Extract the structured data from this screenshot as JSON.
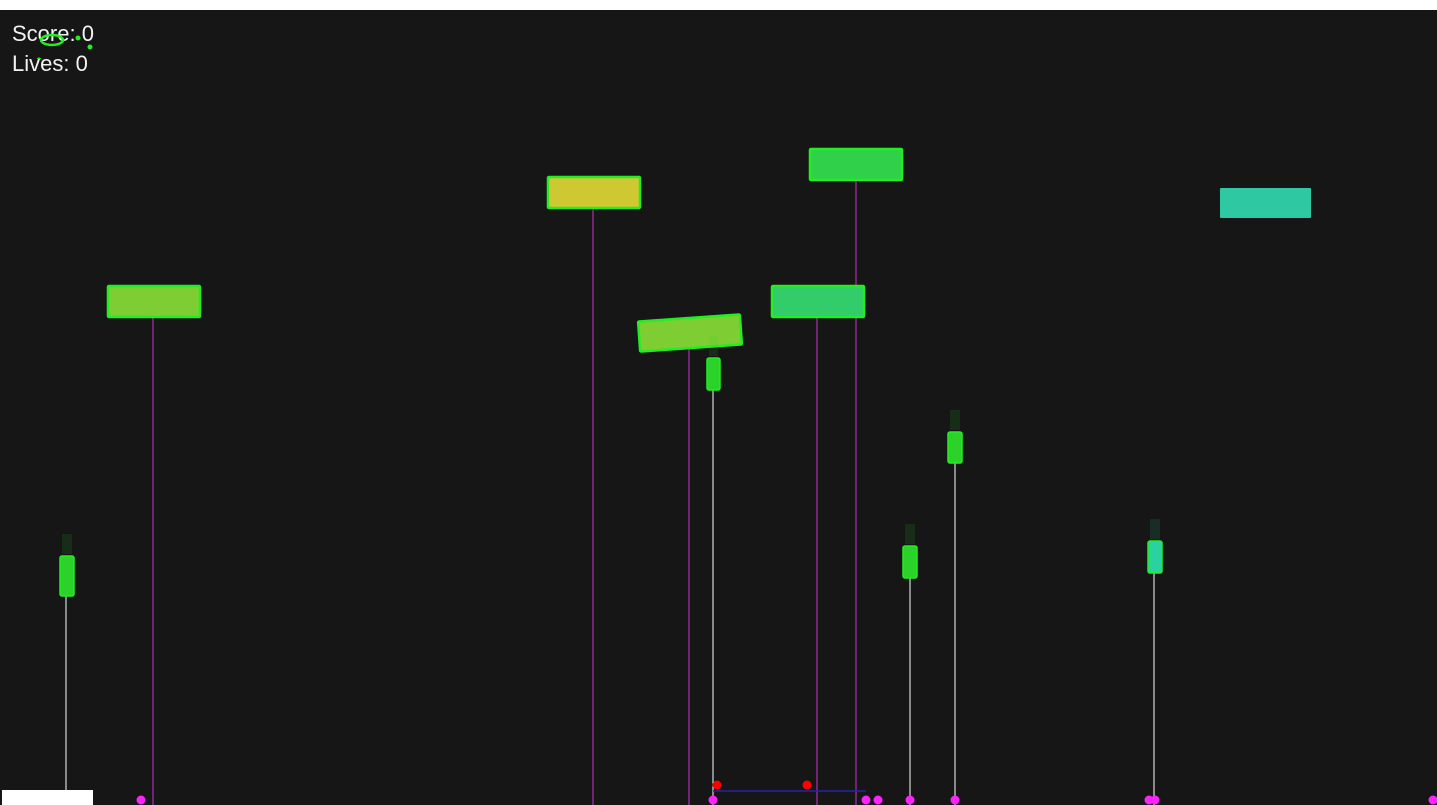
{
  "hud": {
    "score_label": "Score: 0",
    "lives_label": "Lives: 0"
  },
  "colors": {
    "background": "#161616",
    "outline": "#22ee22",
    "debug_line": "#cc33cc",
    "bullet_line": "#ffffff",
    "marker": "#ff22ff",
    "cannon_marker": "#ff0000",
    "cannon_line": "#2222aa",
    "floor_pad": "#ffffff"
  },
  "bricks": [
    {
      "color": "#7dcd33",
      "outlined": true,
      "angle": 0
    },
    {
      "color": "#cec933",
      "outlined": true,
      "angle": 0
    },
    {
      "color": "#30d04a",
      "outlined": true,
      "angle": 0
    },
    {
      "color": "#7dcd33",
      "outlined": true,
      "angle": -4
    },
    {
      "color": "#32cc6b",
      "outlined": true,
      "angle": 0
    },
    {
      "color": "#2ec9a3",
      "outlined": false,
      "angle": 0
    }
  ],
  "bullets": [
    {
      "color": "#2ad22a"
    },
    {
      "color": "#2ad22a"
    },
    {
      "color": "#2ad22a"
    },
    {
      "color": "#2ad22a"
    },
    {
      "color": "#2ad2a0"
    }
  ]
}
